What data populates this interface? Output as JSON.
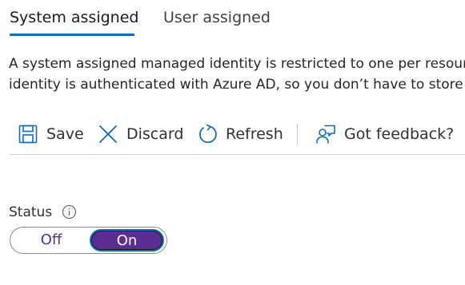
{
  "tabs": [
    {
      "label": "System assigned",
      "active": true
    },
    {
      "label": "User assigned",
      "active": false
    }
  ],
  "description": {
    "line1": "A system assigned managed identity is restricted to one per resour",
    "line2": "identity is authenticated with Azure AD, so you don’t have to store"
  },
  "toolbar": {
    "save_label": "Save",
    "save_icon": "save-icon",
    "discard_label": "Discard",
    "discard_icon": "close-icon",
    "refresh_label": "Refresh",
    "refresh_icon": "refresh-icon",
    "feedback_label": "Got feedback?",
    "feedback_icon": "feedback-icon"
  },
  "status": {
    "label": "Status",
    "info_icon": "info-icon",
    "toggle": {
      "off_label": "Off",
      "on_label": "On",
      "selected": "On"
    }
  },
  "colors": {
    "tab_underline": "#0f6cbd",
    "icon_blue": "#0f6cbd",
    "toggle_on_bg": "#5c2d91",
    "toggle_off_text": "#5c2e91"
  }
}
